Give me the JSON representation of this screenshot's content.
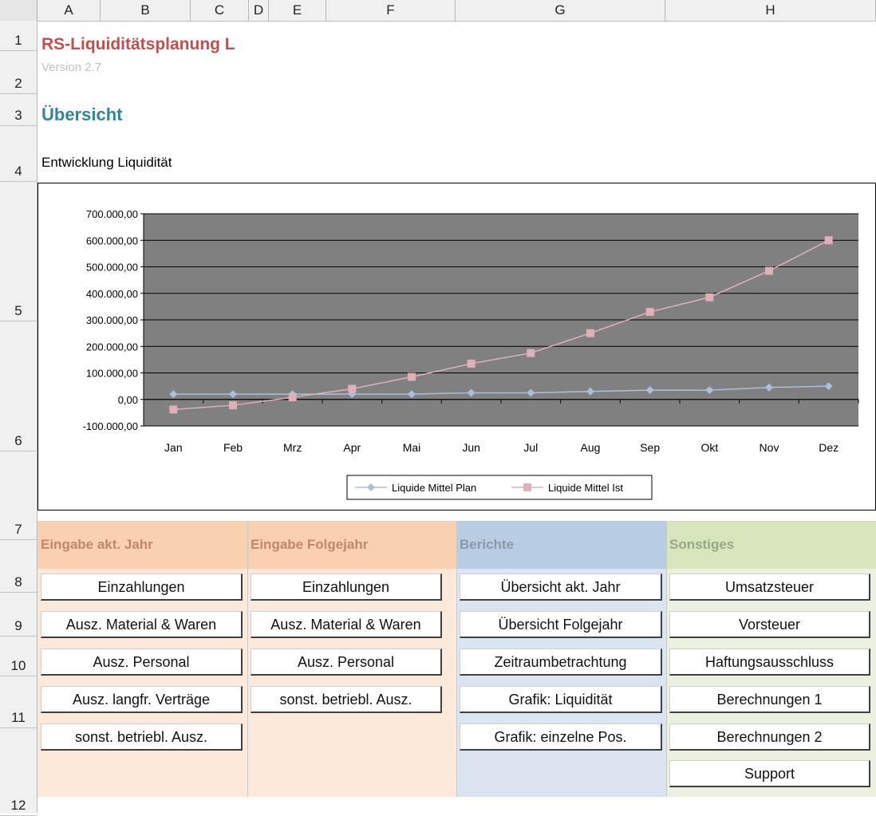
{
  "spreadsheet": {
    "columns": [
      "A",
      "B",
      "C",
      "D",
      "E",
      "F",
      "G",
      "H"
    ],
    "rows": [
      "1",
      "2",
      "3",
      "4",
      "5",
      "6",
      "7",
      "8",
      "9",
      "10",
      "11",
      "12"
    ]
  },
  "header": {
    "title": "RS-Liquiditätsplanung L",
    "version": "Version 2.7",
    "section": "Übersicht",
    "chart_label": "Entwicklung Liquidität"
  },
  "chart_data": {
    "type": "line",
    "categories": [
      "Jan",
      "Feb",
      "Mrz",
      "Apr",
      "Mai",
      "Jun",
      "Jul",
      "Aug",
      "Sep",
      "Okt",
      "Nov",
      "Dez"
    ],
    "ylim": [
      -100000,
      700000
    ],
    "yticks": [
      "700.000,00",
      "600.000,00",
      "500.000,00",
      "400.000,00",
      "300.000,00",
      "200.000,00",
      "100.000,00",
      "0,00",
      "-100.000,00"
    ],
    "grid": true,
    "legend_position": "bottom",
    "plot_background": "#808080",
    "series": [
      {
        "name": "Liquide Mittel Plan",
        "color": "#a8c0dc",
        "marker": "diamond",
        "values": [
          20000,
          20000,
          20000,
          20000,
          20000,
          25000,
          25000,
          30000,
          35000,
          35000,
          45000,
          50000
        ]
      },
      {
        "name": "Liquide Mittel Ist",
        "color": "#e0b0b8",
        "marker": "square",
        "values": [
          -38000,
          -22000,
          8000,
          40000,
          85000,
          135000,
          175000,
          250000,
          330000,
          385000,
          485000,
          600000
        ]
      }
    ]
  },
  "panels": [
    {
      "title": "Eingabe akt. Jahr",
      "header_color": "#fad0b0",
      "body_color": "#fde9d9",
      "title_color": "#c08868",
      "buttons": [
        "Einzahlungen",
        "Ausz. Material & Waren",
        "Ausz. Personal",
        "Ausz. langfr. Verträge",
        "sonst. betriebl. Ausz."
      ]
    },
    {
      "title": "Eingabe Folgejahr",
      "header_color": "#fad0b0",
      "body_color": "#fde9d9",
      "title_color": "#c08868",
      "buttons": [
        "Einzahlungen",
        "Ausz. Material & Waren",
        "Ausz. Personal",
        "sonst. betriebl. Ausz."
      ]
    },
    {
      "title": "Berichte",
      "header_color": "#b8cce4",
      "body_color": "#dbe5f1",
      "title_color": "#8a9aac",
      "buttons": [
        "Übersicht akt. Jahr",
        "Übersicht Folgejahr",
        "Zeitraumbetrachtung",
        "Grafik: Liquidität",
        "Grafik: einzelne Pos."
      ]
    },
    {
      "title": "Sonstiges",
      "header_color": "#d8e4bc",
      "body_color": "#ebf1de",
      "title_color": "#98a888",
      "buttons": [
        "Umsatzsteuer",
        "Vorsteuer",
        "Haftungsausschluss",
        "Berechnungen 1",
        "Berechnungen 2",
        "Support"
      ]
    }
  ]
}
